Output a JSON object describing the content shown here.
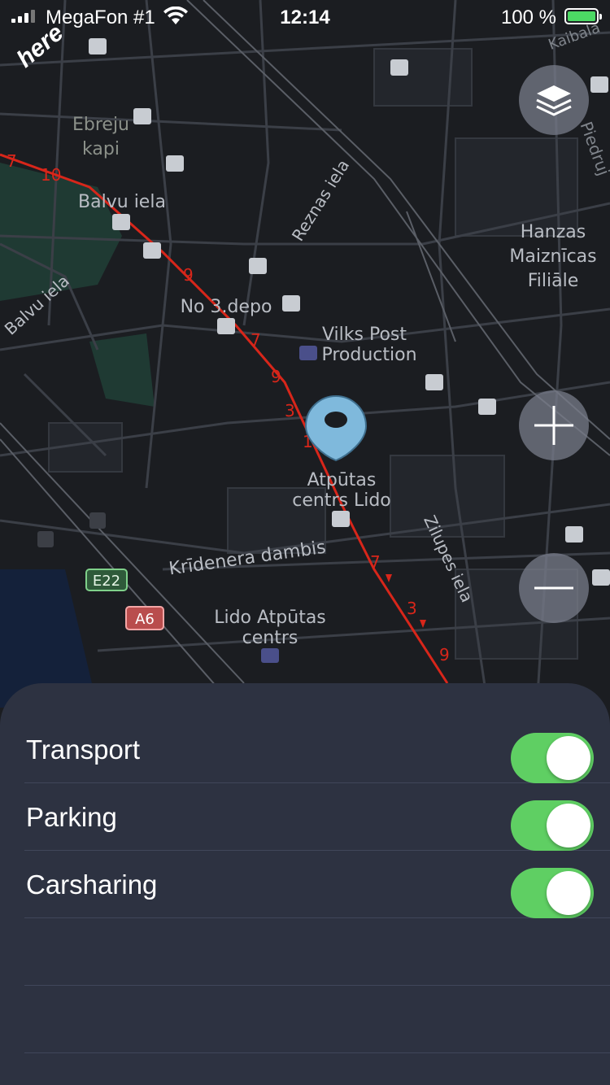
{
  "status_bar": {
    "carrier": "MegaFon #1",
    "time": "12:14",
    "battery": "100 %"
  },
  "map": {
    "logo": "here",
    "labels": {
      "ebreju": "Ebreju",
      "kapi": "kapi",
      "balvu_iela_top": "Balvu iela",
      "balvu_iela_left": "Balvu iela",
      "reznas_iela": "Reznas iela",
      "hanzas": "Hanzas",
      "maiznicas": "Maiznīcas",
      "filiale": "Filiāle",
      "no3depo": "No 3.depo",
      "vilks_post": "Vilks Post",
      "production": "Production",
      "atputas": "Atpūtas",
      "centrs_lido": "centrs Lido",
      "zilupes_iela": "Zilupes iela",
      "kridenera": "Krīdenera dambis",
      "lido_atputas": "Lido Atpūtas",
      "centrs": "centrs",
      "kaibala": "Kaibala",
      "piedruj": "Piedruj",
      "e22": "E22",
      "a6": "A6",
      "route_nums": [
        "7",
        "10",
        "9",
        "7",
        "9",
        "3",
        "1",
        "7",
        "3",
        "9"
      ]
    },
    "buttons": {
      "layers": "layers-icon",
      "zoom_in": "plus-icon",
      "zoom_out": "minus-icon"
    },
    "colors": {
      "background": "#1b1d21",
      "route": "#d8261a",
      "pin": "#7fb9dc",
      "toggle_on": "#5fcf63",
      "sheet": "#2d3241"
    }
  },
  "sheet": {
    "rows": [
      {
        "label": "Transport",
        "on": true
      },
      {
        "label": "Parking",
        "on": true
      },
      {
        "label": "Carsharing",
        "on": true
      }
    ]
  }
}
